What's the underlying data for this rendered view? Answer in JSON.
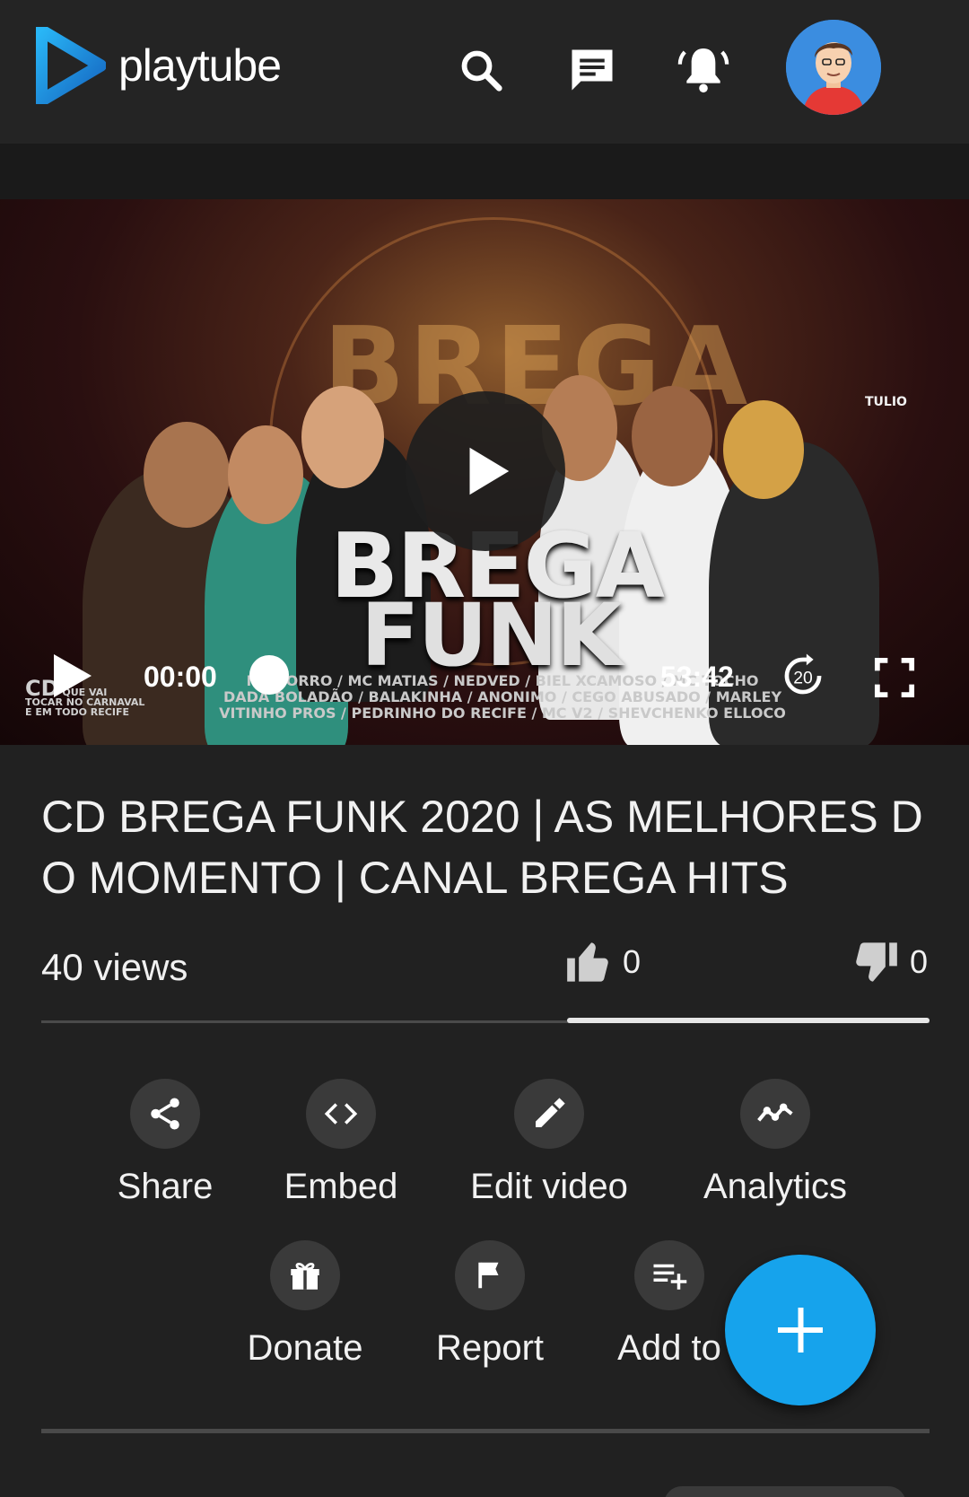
{
  "header": {
    "logo_text": "playtube",
    "icons": [
      "search-icon",
      "messages-icon",
      "notifications-bell-icon",
      "user-avatar"
    ]
  },
  "video": {
    "thumbnail": {
      "background_word": "BREGA",
      "title_line1": "BREGA",
      "title_line2": "FUNK",
      "credits_line1": "MC TORRO / MC MATIAS / NEDVED / BIEL XCAMOSO / MC TOCHO",
      "credits_line2": "DADA BOLADÃO / BALAKINHA / ANONIMO / CEGO ABUSADO / MARLEY",
      "credits_line3": "VITINHO PROS / PEDRINHO DO RECIFE / MC V2 / SHEVCHENKO ELLOCO",
      "cd_big": "CD",
      "cd_small1": "QUE VAI",
      "cd_small2": "TOCAR NO CARNAVAL",
      "cd_small3": "E EM TODO RECIFE",
      "brand_mark": "TULIO"
    },
    "current_time": "00:00",
    "duration": "53:42",
    "forward_seconds": "20",
    "progress": 0
  },
  "info": {
    "title": "CD BREGA FUNK 2020 | AS MELHORES DO MOMENTO | CANAL BREGA HITS",
    "views": "40 views",
    "likes": "0",
    "dislikes": "0"
  },
  "actions": [
    {
      "label": "Share",
      "icon": "share-icon"
    },
    {
      "label": "Embed",
      "icon": "code-icon"
    },
    {
      "label": "Edit video",
      "icon": "pencil-icon"
    },
    {
      "label": "Analytics",
      "icon": "analytics-icon"
    },
    {
      "label": "Donate",
      "icon": "gift-icon"
    },
    {
      "label": "Report",
      "icon": "flag-icon"
    },
    {
      "label": "Add to",
      "icon": "playlist-add-icon"
    }
  ],
  "colors": {
    "background": "#212121",
    "accent": "#16a3ec",
    "logo_blue": "#1e88e5"
  }
}
